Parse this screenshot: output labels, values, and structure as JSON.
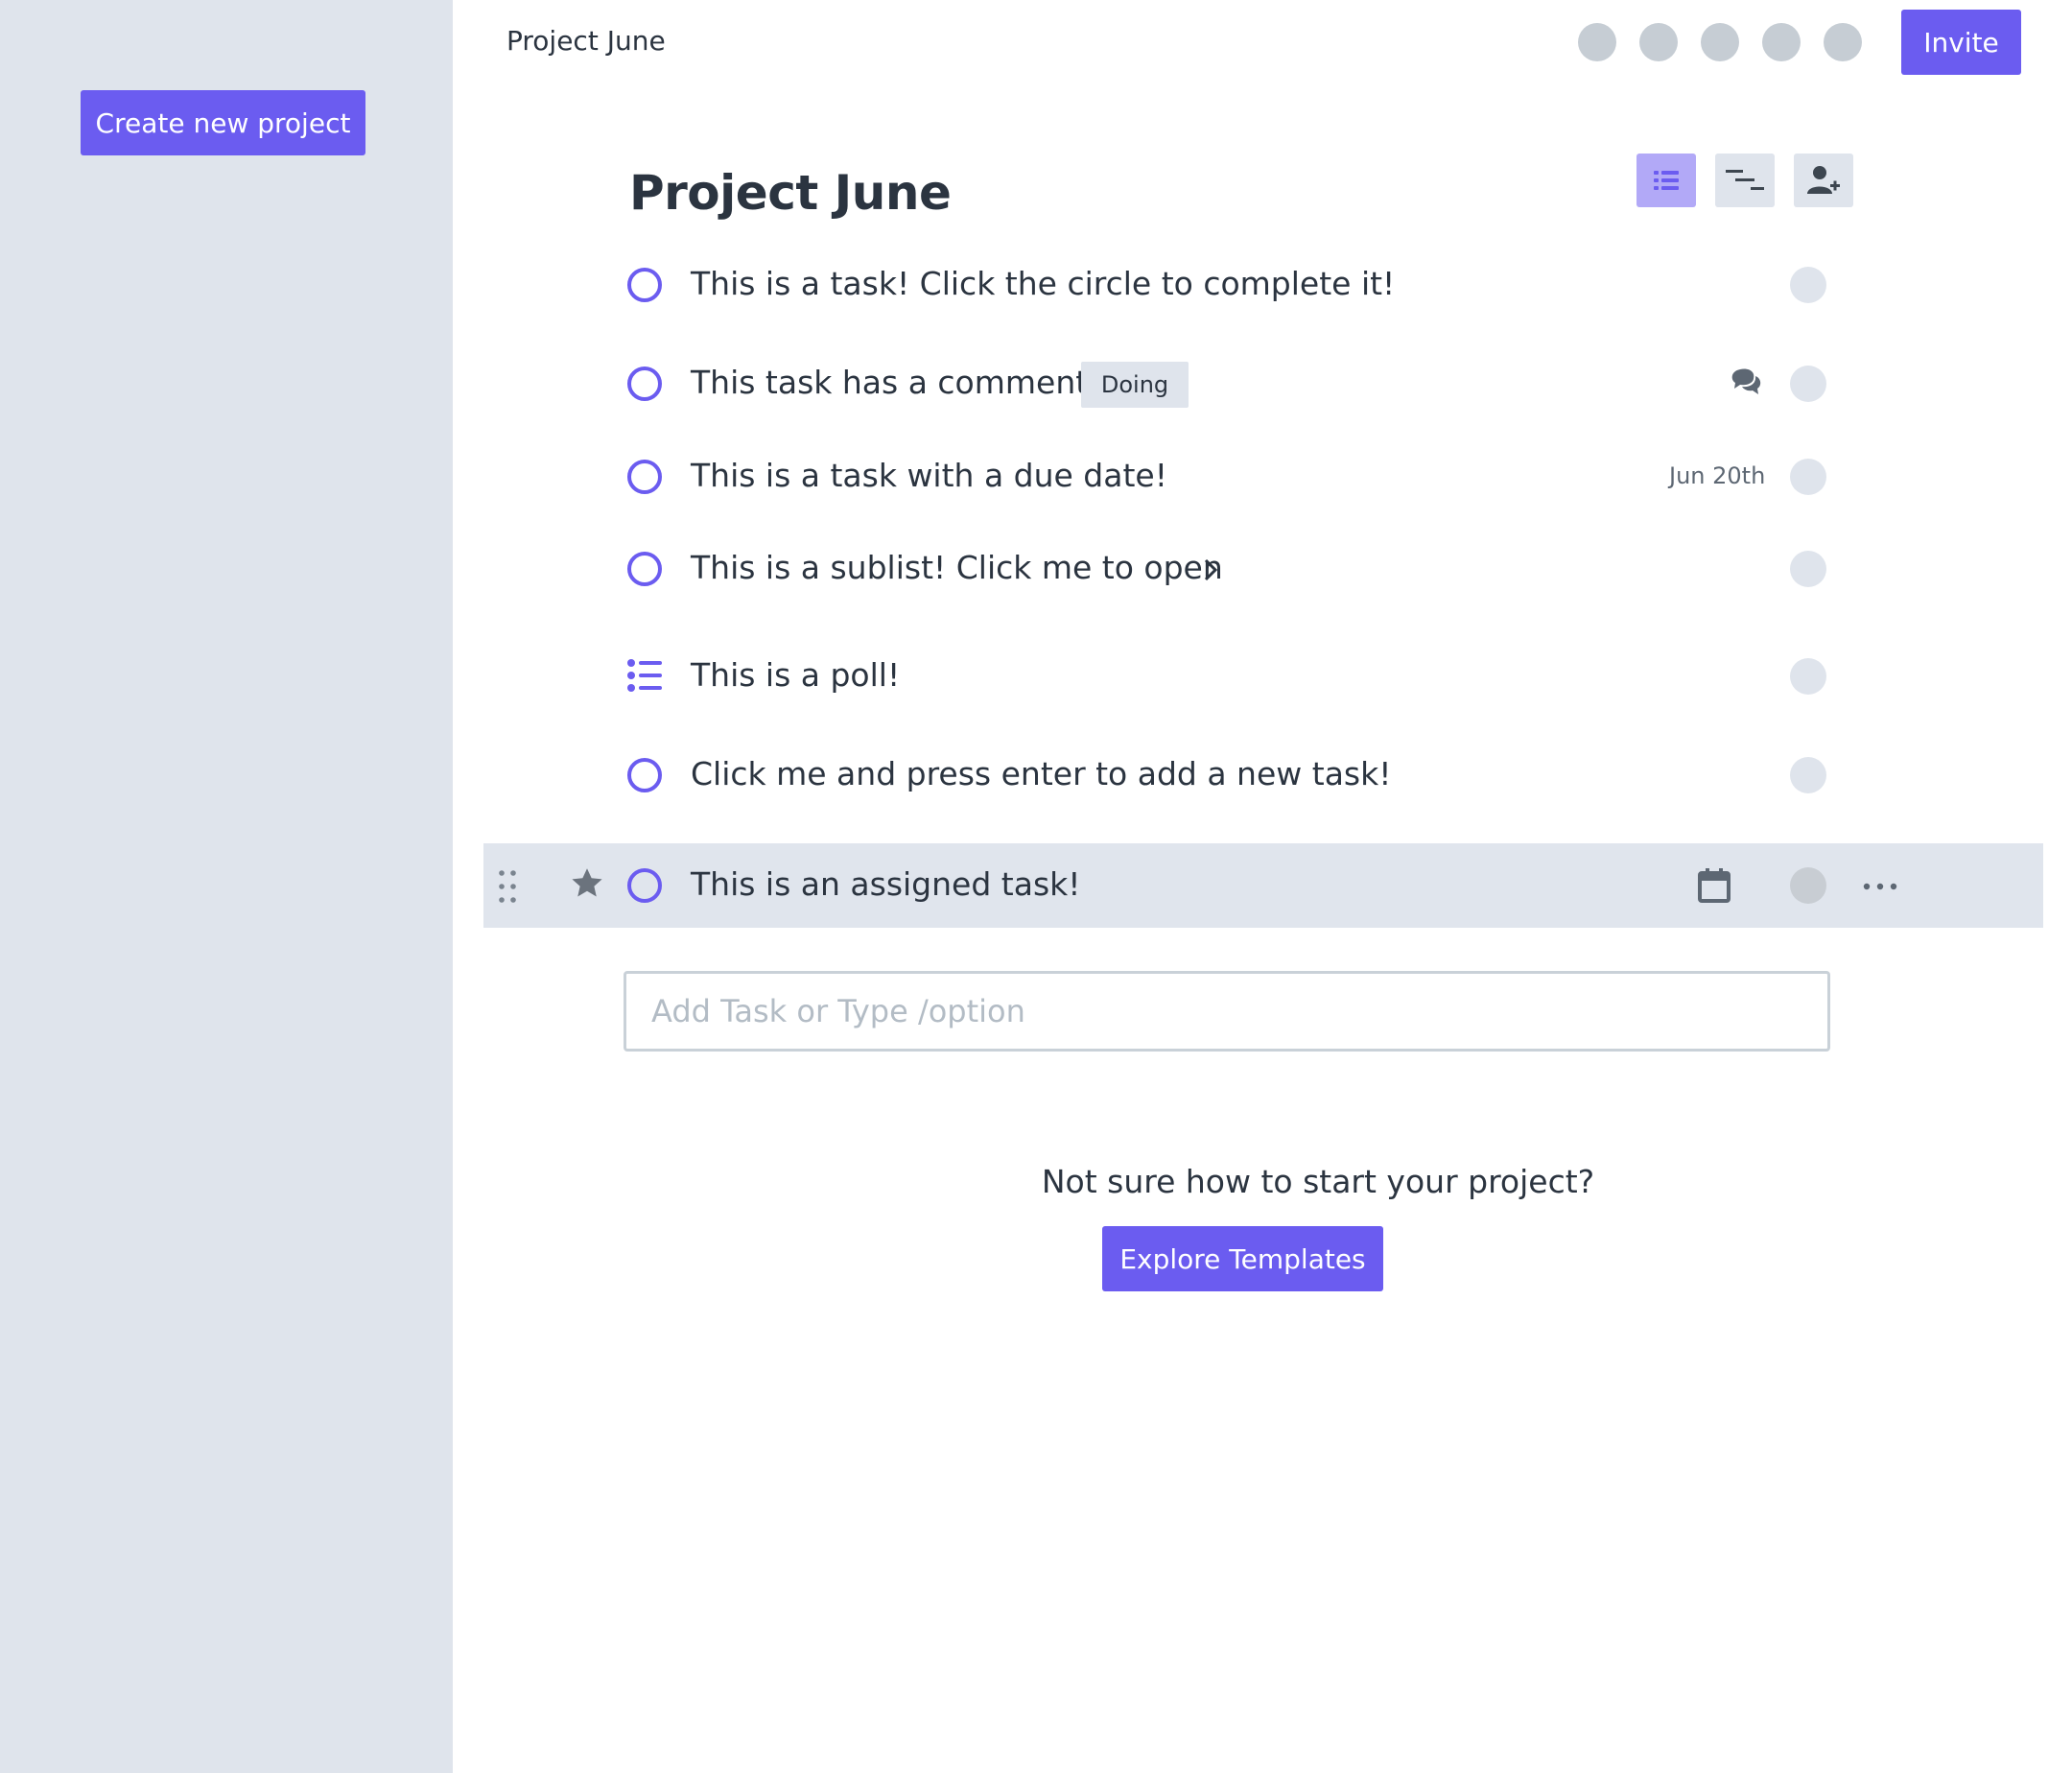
{
  "sidebar": {
    "create_label": "Create new project"
  },
  "topbar": {
    "title": "Project June",
    "invite_label": "Invite"
  },
  "project": {
    "title": "Project June"
  },
  "tasks": [
    {
      "label": "This is a task! Click the circle to complete it!"
    },
    {
      "label": "This task has a comment",
      "badge": "Doing"
    },
    {
      "label": "This is a task with a due date!",
      "due": "Jun 20th"
    },
    {
      "label": "This is a sublist! Click me to open"
    },
    {
      "label": "This is a poll!"
    },
    {
      "label": "Click me and press enter to add a new task!"
    },
    {
      "label": "This is an assigned task!"
    }
  ],
  "add_task": {
    "placeholder": "Add Task or Type /option"
  },
  "empty_prompt": {
    "text": "Not sure how to start your project?",
    "button": "Explore Templates"
  },
  "colors": {
    "accent": "#6b5cf0",
    "sidebar": "#dfe4ec",
    "text": "#2b3440"
  }
}
